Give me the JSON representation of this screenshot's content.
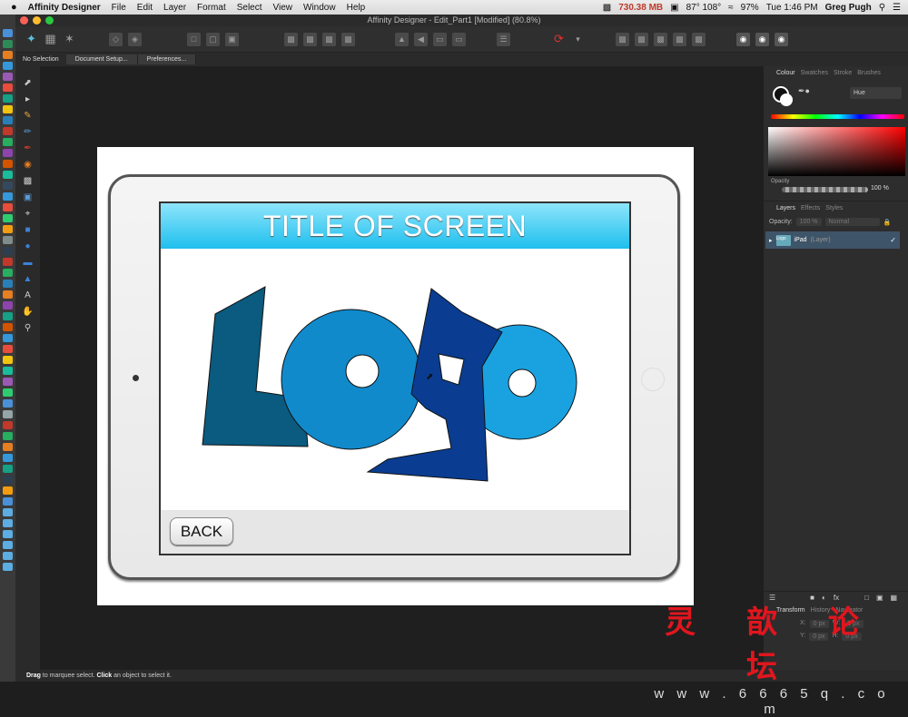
{
  "menubar": {
    "apple": "",
    "app_name": "Affinity Designer",
    "items": [
      "File",
      "Edit",
      "Layer",
      "Format",
      "Select",
      "View",
      "Window",
      "Help"
    ],
    "memory": "730.38 MB",
    "temp": "87° 108°",
    "battery": "97%",
    "clock": "Tue 1:46 PM",
    "user": "Greg Pugh"
  },
  "window": {
    "title": "Affinity Designer - Edit_Part1 [Modified] (80.8%)"
  },
  "context": {
    "selection": "No Selection",
    "document_setup": "Document Setup...",
    "preferences": "Preferences..."
  },
  "screen": {
    "title": "TITLE OF SCREEN",
    "back": "BACK",
    "colors": {
      "title_bar": "#1ebfee",
      "logo_dark": "#0b5a7f",
      "logo_mid": "#118acc",
      "logo_navy": "#0a3d91",
      "logo_light": "#1aa2e0"
    }
  },
  "colour_panel": {
    "tabs": [
      "Colour",
      "Swatches",
      "Stroke",
      "Brushes"
    ],
    "mode": "Hue",
    "opacity_label": "Opacity",
    "opacity_value": "100 %"
  },
  "layers_panel": {
    "tabs": [
      "Layers",
      "Effects",
      "Styles"
    ],
    "opacity_label": "Opacity:",
    "opacity_value": "100 %",
    "blend_mode": "Normal",
    "layer_name": "iPad",
    "layer_type": "(Layer)",
    "thumb_text": "Logo"
  },
  "transform_panel": {
    "tabs": [
      "Transform",
      "History",
      "Navigator"
    ],
    "x_label": "X:",
    "x_value": "0 px",
    "y_label": "Y:",
    "y_value": "0 px",
    "w_label": "W:",
    "w_value": "0 px",
    "h_label": "H:",
    "h_value": "0 px"
  },
  "status": {
    "drag": "Drag",
    "drag_text": " to marquee select. ",
    "click": "Click",
    "click_text": " an object to select it."
  },
  "watermark": {
    "chars": "灵 歆 论 坛",
    "url": "w w w . 6 6 6 5 q . c o m"
  }
}
